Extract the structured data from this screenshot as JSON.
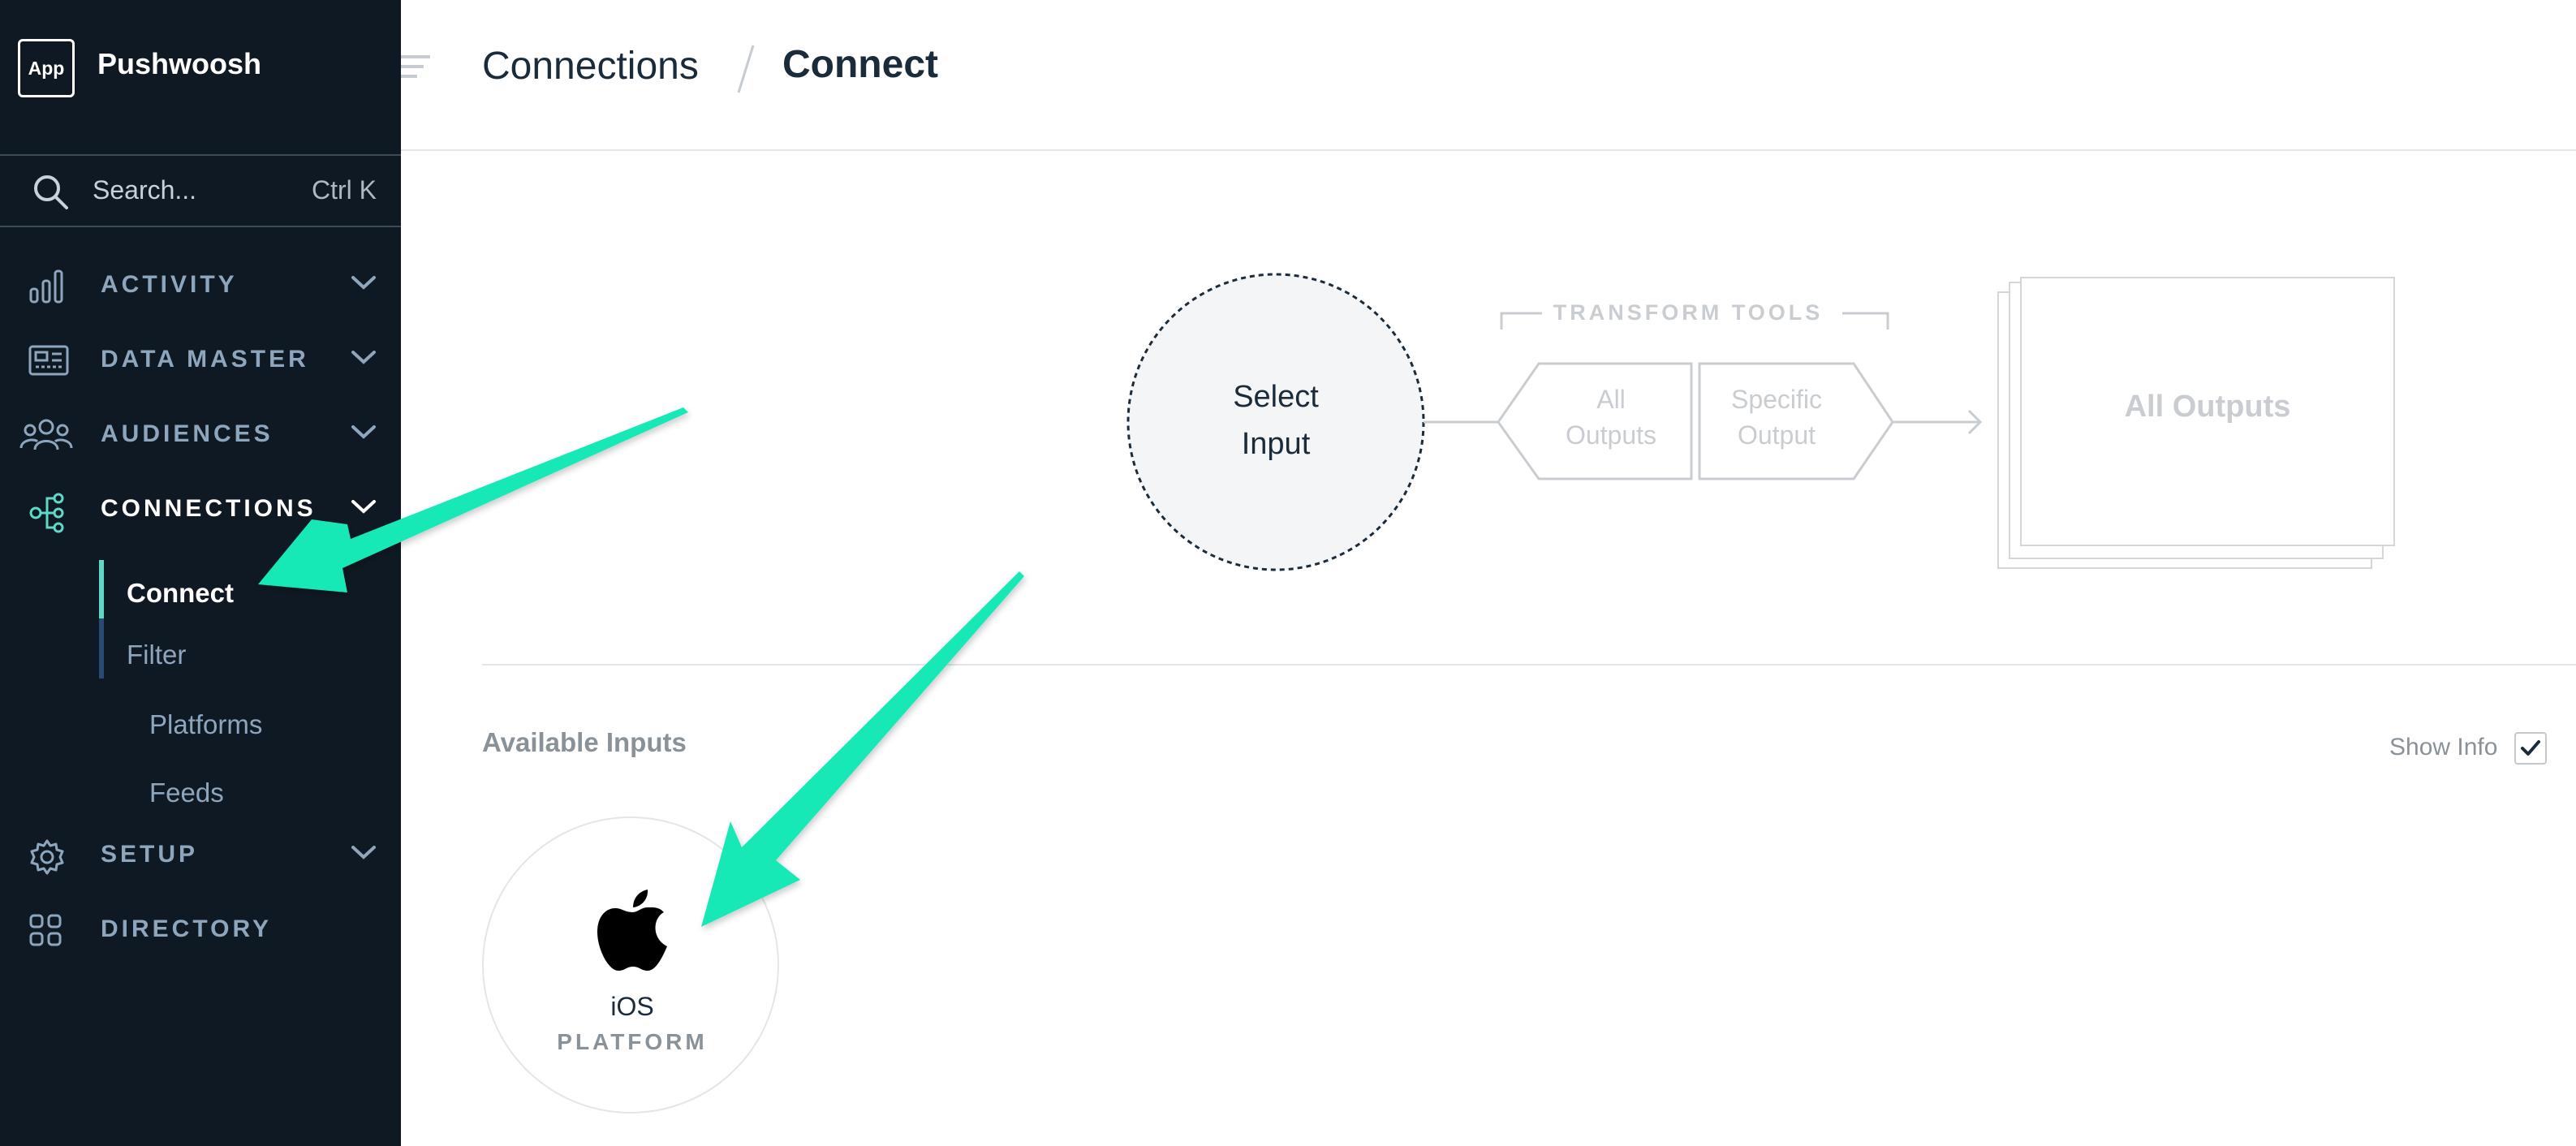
{
  "colors": {
    "sidebar_bg": "#0f1923",
    "nav_text": "#8ea6bd",
    "accent_teal": "#18e8b6",
    "active_marker": "#5fd8c6"
  },
  "app": {
    "badge": "App",
    "name": "Pushwoosh"
  },
  "search": {
    "placeholder": "Search...",
    "shortcut": "Ctrl K",
    "icon": "search-icon"
  },
  "nav": {
    "items": [
      {
        "label": "ACTIVITY",
        "icon": "bar-chart-icon",
        "expanded": false
      },
      {
        "label": "DATA MASTER",
        "icon": "dashboard-icon",
        "expanded": false
      },
      {
        "label": "AUDIENCES",
        "icon": "users-icon",
        "expanded": false
      },
      {
        "label": "CONNECTIONS",
        "icon": "connections-icon",
        "expanded": true
      },
      {
        "label": "SETUP",
        "icon": "gear-icon",
        "expanded": false
      },
      {
        "label": "DIRECTORY",
        "icon": "grid-icon",
        "expanded": false
      }
    ],
    "connections_sub": [
      {
        "label": "Connect",
        "active": true
      },
      {
        "label": "Filter",
        "active": false
      },
      {
        "label": "Platforms",
        "active": false
      },
      {
        "label": "Feeds",
        "active": false
      }
    ]
  },
  "header": {
    "breadcrumb_parent": "Connections",
    "breadcrumb_current": "Connect"
  },
  "flow": {
    "select_input_line1": "Select",
    "select_input_line2": "Input",
    "transform_tools": "TRANSFORM TOOLS",
    "all_outputs_line1": "All",
    "all_outputs_line2": "Outputs",
    "specific_output_line1": "Specific",
    "specific_output_line2": "Output",
    "all_outputs_box": "All Outputs"
  },
  "inputs": {
    "section_title": "Available Inputs",
    "show_info_label": "Show Info",
    "show_info_checked": true,
    "cards": [
      {
        "name": "iOS",
        "type": "PLATFORM",
        "icon": "apple-icon"
      }
    ]
  }
}
